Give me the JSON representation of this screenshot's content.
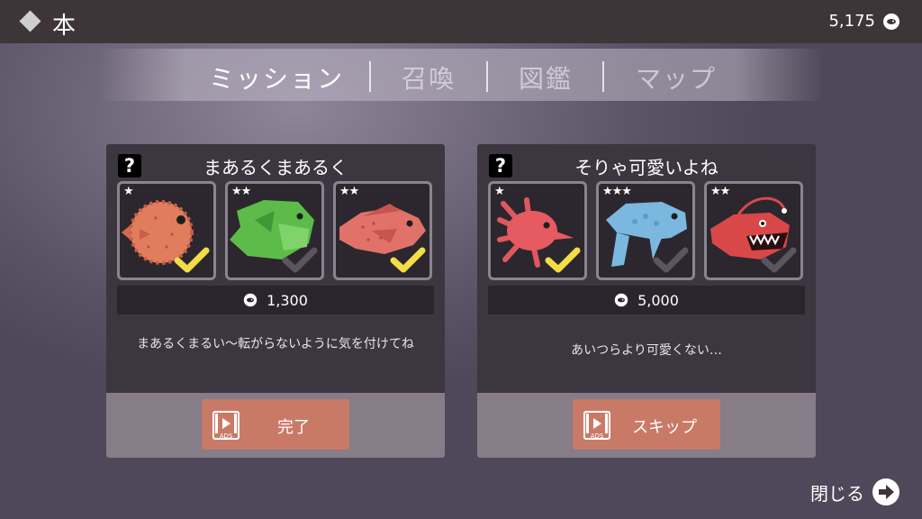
{
  "header": {
    "title": "本",
    "coins": "5,175",
    "diamond_icon": "diamond-icon",
    "coin_icon": "fish-coin-icon"
  },
  "tabs": [
    {
      "label": "ミッション",
      "active": true
    },
    {
      "label": "召喚",
      "active": false
    },
    {
      "label": "図鑑",
      "active": false
    },
    {
      "label": "マップ",
      "active": false
    }
  ],
  "cards": [
    {
      "title": "まあるくまあるく",
      "help_icon": "question-icon",
      "fish": [
        {
          "stars": "★",
          "name": "pufferfish",
          "checked": true
        },
        {
          "stars": "★★",
          "name": "green-fish",
          "checked": false
        },
        {
          "stars": "★★",
          "name": "red-snapper",
          "checked": true
        }
      ],
      "reward": "1,300",
      "description": "まあるくまるい〜転がらないように気を付けてね",
      "button_label": "完了",
      "button_badge": "ADS"
    },
    {
      "title": "そりゃ可愛いよね",
      "help_icon": "question-icon",
      "fish": [
        {
          "stars": "★",
          "name": "red-lionfish",
          "checked": true
        },
        {
          "stars": "★★★",
          "name": "blue-sunfish",
          "checked": false
        },
        {
          "stars": "★★",
          "name": "anglerfish",
          "checked": false
        }
      ],
      "reward": "5,000",
      "description": "あいつらより可愛くない…",
      "button_label": "スキップ",
      "button_badge": "ADS"
    }
  ],
  "footer": {
    "close_label": "閉じる",
    "close_icon": "arrow-right-circle-icon"
  },
  "colors": {
    "check_yellow": "#f2dd45",
    "check_gray": "#5a5560",
    "button": "#c97a67",
    "card": "#3c3640"
  }
}
